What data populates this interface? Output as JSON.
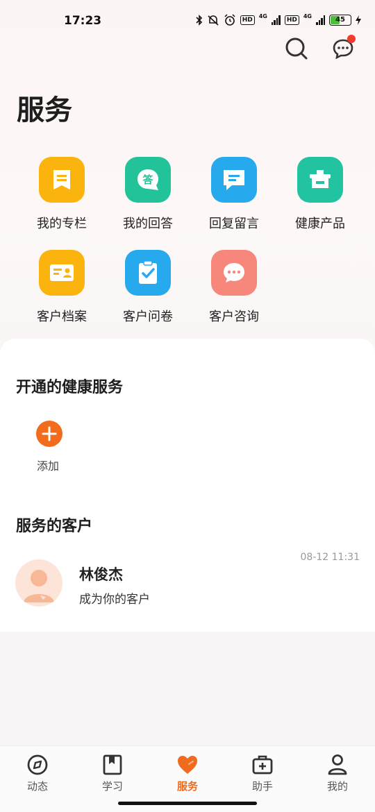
{
  "status_bar": {
    "time": "17:23",
    "hd1": "HD",
    "net1": "4G",
    "hd2": "HD",
    "net2": "4G",
    "battery": "45"
  },
  "header": {
    "title": "服务"
  },
  "services": [
    {
      "label": "我的专栏",
      "icon": "column-icon",
      "color": "#fbb40e"
    },
    {
      "label": "我的回答",
      "icon": "answer-icon",
      "color": "#23c39a",
      "glyph": "答"
    },
    {
      "label": "回复留言",
      "icon": "reply-message-icon",
      "color": "#27a9ee"
    },
    {
      "label": "健康产品",
      "icon": "health-product-icon",
      "color": "#22c3a0"
    },
    {
      "label": "客户档案",
      "icon": "customer-file-icon",
      "color": "#fbb40e"
    },
    {
      "label": "客户问卷",
      "icon": "questionnaire-icon",
      "color": "#27a9ee"
    },
    {
      "label": "客户咨询",
      "icon": "consult-icon",
      "color": "#f7877a"
    }
  ],
  "health_services": {
    "title": "开通的健康服务",
    "add_label": "添加"
  },
  "customers": {
    "title": "服务的客户",
    "items": [
      {
        "name": "林俊杰",
        "subtitle": "成为你的客户",
        "time": "08-12 11:31"
      }
    ]
  },
  "tabbar": {
    "tabs": [
      {
        "label": "动态",
        "icon": "compass-icon"
      },
      {
        "label": "学习",
        "icon": "bookmark-book-icon"
      },
      {
        "label": "服务",
        "icon": "heart-icon",
        "active": true
      },
      {
        "label": "助手",
        "icon": "medical-kit-icon"
      },
      {
        "label": "我的",
        "icon": "user-icon"
      }
    ]
  },
  "colors": {
    "accent": "#ef6b1e",
    "badge": "#f23b2e"
  }
}
